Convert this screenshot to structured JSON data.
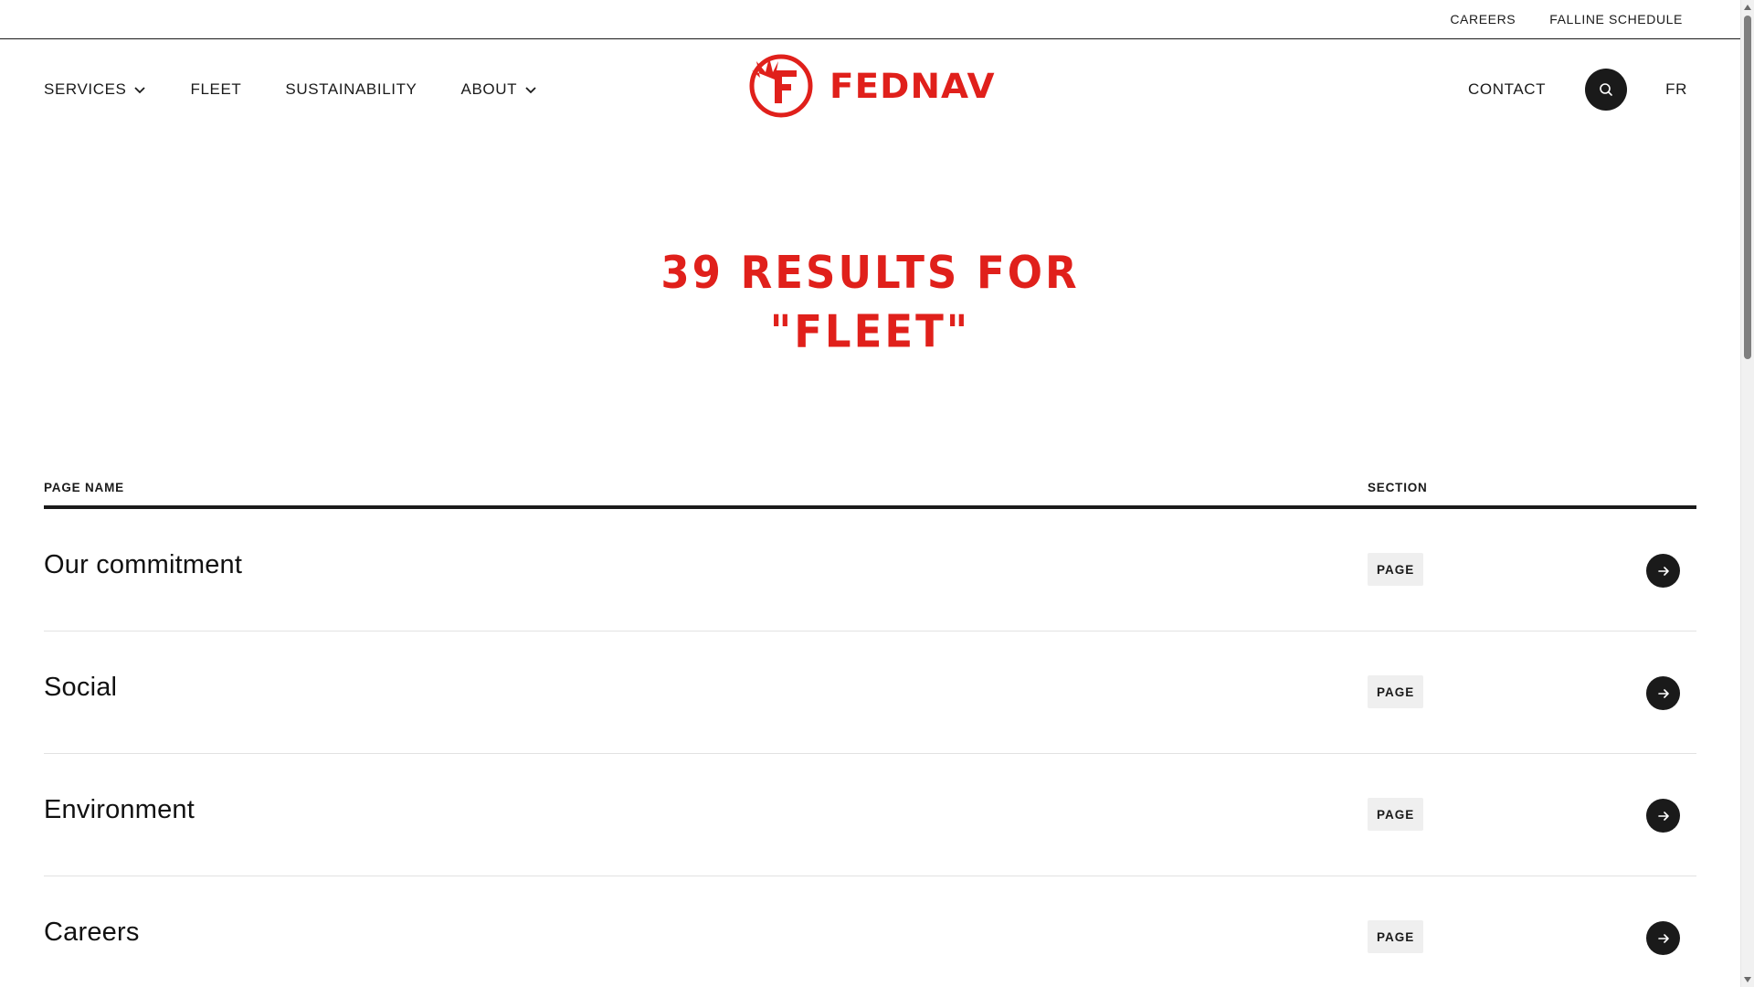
{
  "utility_bar": {
    "links": [
      "CAREERS",
      "FALLINE SCHEDULE"
    ]
  },
  "nav": {
    "items": [
      {
        "label": "SERVICES",
        "has_dropdown": true
      },
      {
        "label": "FLEET",
        "has_dropdown": false
      },
      {
        "label": "SUSTAINABILITY",
        "has_dropdown": false
      },
      {
        "label": "ABOUT",
        "has_dropdown": true
      }
    ],
    "logo_text": "FEDNAV",
    "contact_label": "CONTACT",
    "lang_label": "FR",
    "search_icon": "search-icon"
  },
  "heading": {
    "line1": "39 RESULTS FOR",
    "line2": "\"FLEET\""
  },
  "table": {
    "col_name": "PAGE NAME",
    "col_section": "SECTION",
    "rows": [
      {
        "title": "Our commitment",
        "section": "PAGE"
      },
      {
        "title": "Social",
        "section": "PAGE"
      },
      {
        "title": "Environment",
        "section": "PAGE"
      },
      {
        "title": "Careers",
        "section": "PAGE"
      }
    ]
  },
  "colors": {
    "brand_red": "#e0201b",
    "dark": "#1a1a1a",
    "badge_bg": "#efefef"
  }
}
